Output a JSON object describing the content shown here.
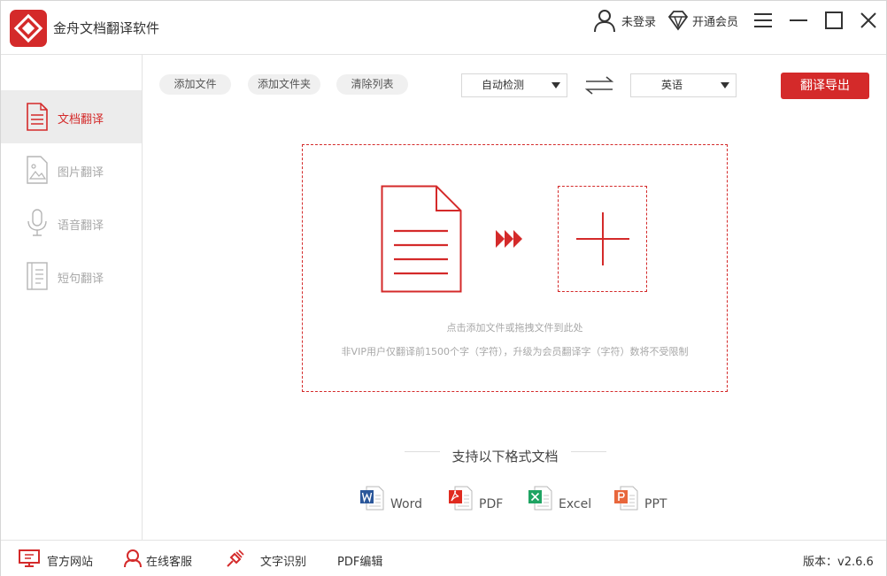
{
  "app": {
    "title": "金舟文档翻译软件",
    "accent": "#d42a2a"
  },
  "header": {
    "login": "未登录",
    "vip": "开通会员"
  },
  "sidebar": {
    "items": [
      {
        "label": "文档翻译",
        "icon": "document-icon",
        "active": true
      },
      {
        "label": "图片翻译",
        "icon": "image-icon",
        "active": false
      },
      {
        "label": "语音翻译",
        "icon": "microphone-icon",
        "active": false
      },
      {
        "label": "短句翻译",
        "icon": "text-sentence-icon",
        "active": false
      }
    ]
  },
  "toolbar": {
    "add_file": "添加文件",
    "add_folder": "添加文件夹",
    "clear_list": "清除列表",
    "source_lang": "自动检测",
    "target_lang": "英语",
    "export": "翻译导出"
  },
  "dropzone": {
    "hint": "点击添加文件或拖拽文件到此处",
    "vip_notice": "非VIP用户仅翻译前1500个字（字符），升级为会员翻译字（字符）数将不受限制"
  },
  "formats": {
    "title": "支持以下格式文档",
    "items": [
      {
        "label": "Word",
        "icon": "word-icon",
        "color": "#2b579a"
      },
      {
        "label": "PDF",
        "icon": "pdf-icon",
        "color": "#e02b20"
      },
      {
        "label": "Excel",
        "icon": "excel-icon",
        "color": "#1fa463"
      },
      {
        "label": "PPT",
        "icon": "ppt-icon",
        "color": "#e8673c"
      }
    ]
  },
  "footer": {
    "website": "官方网站",
    "service": "在线客服",
    "ocr": "文字识别",
    "pdf_edit": "PDF编辑",
    "version": "版本：v2.6.6"
  }
}
